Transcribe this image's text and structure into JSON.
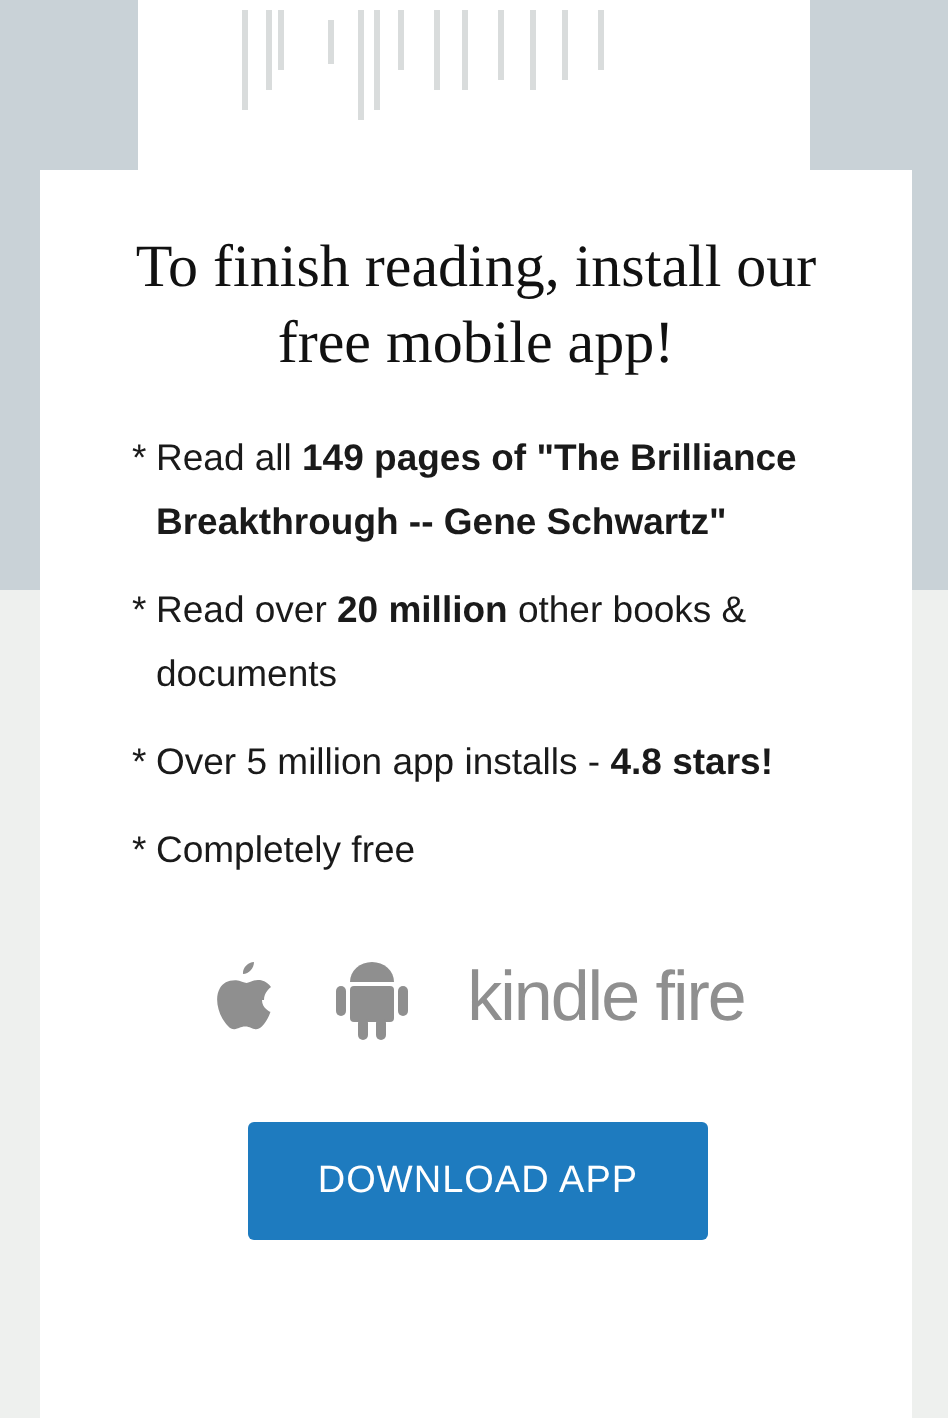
{
  "modal": {
    "title": "To finish reading, install our free mobile app!",
    "bullets": [
      {
        "marker": "*",
        "text": "Read all **149 pages of \"The Brilliance Breakthrough -- Gene Schwartz\"**"
      },
      {
        "marker": "*",
        "text": "Read over **20 million** other books & documents"
      },
      {
        "marker": "*",
        "text": "Over 5 million app installs - **4.8 stars!**"
      },
      {
        "marker": "*",
        "text": "Completely free"
      }
    ],
    "platforms": [
      {
        "kind": "apple"
      },
      {
        "kind": "android"
      },
      {
        "kind": "text",
        "label": "kindle fire"
      }
    ],
    "button": "DOWNLOAD APP"
  }
}
